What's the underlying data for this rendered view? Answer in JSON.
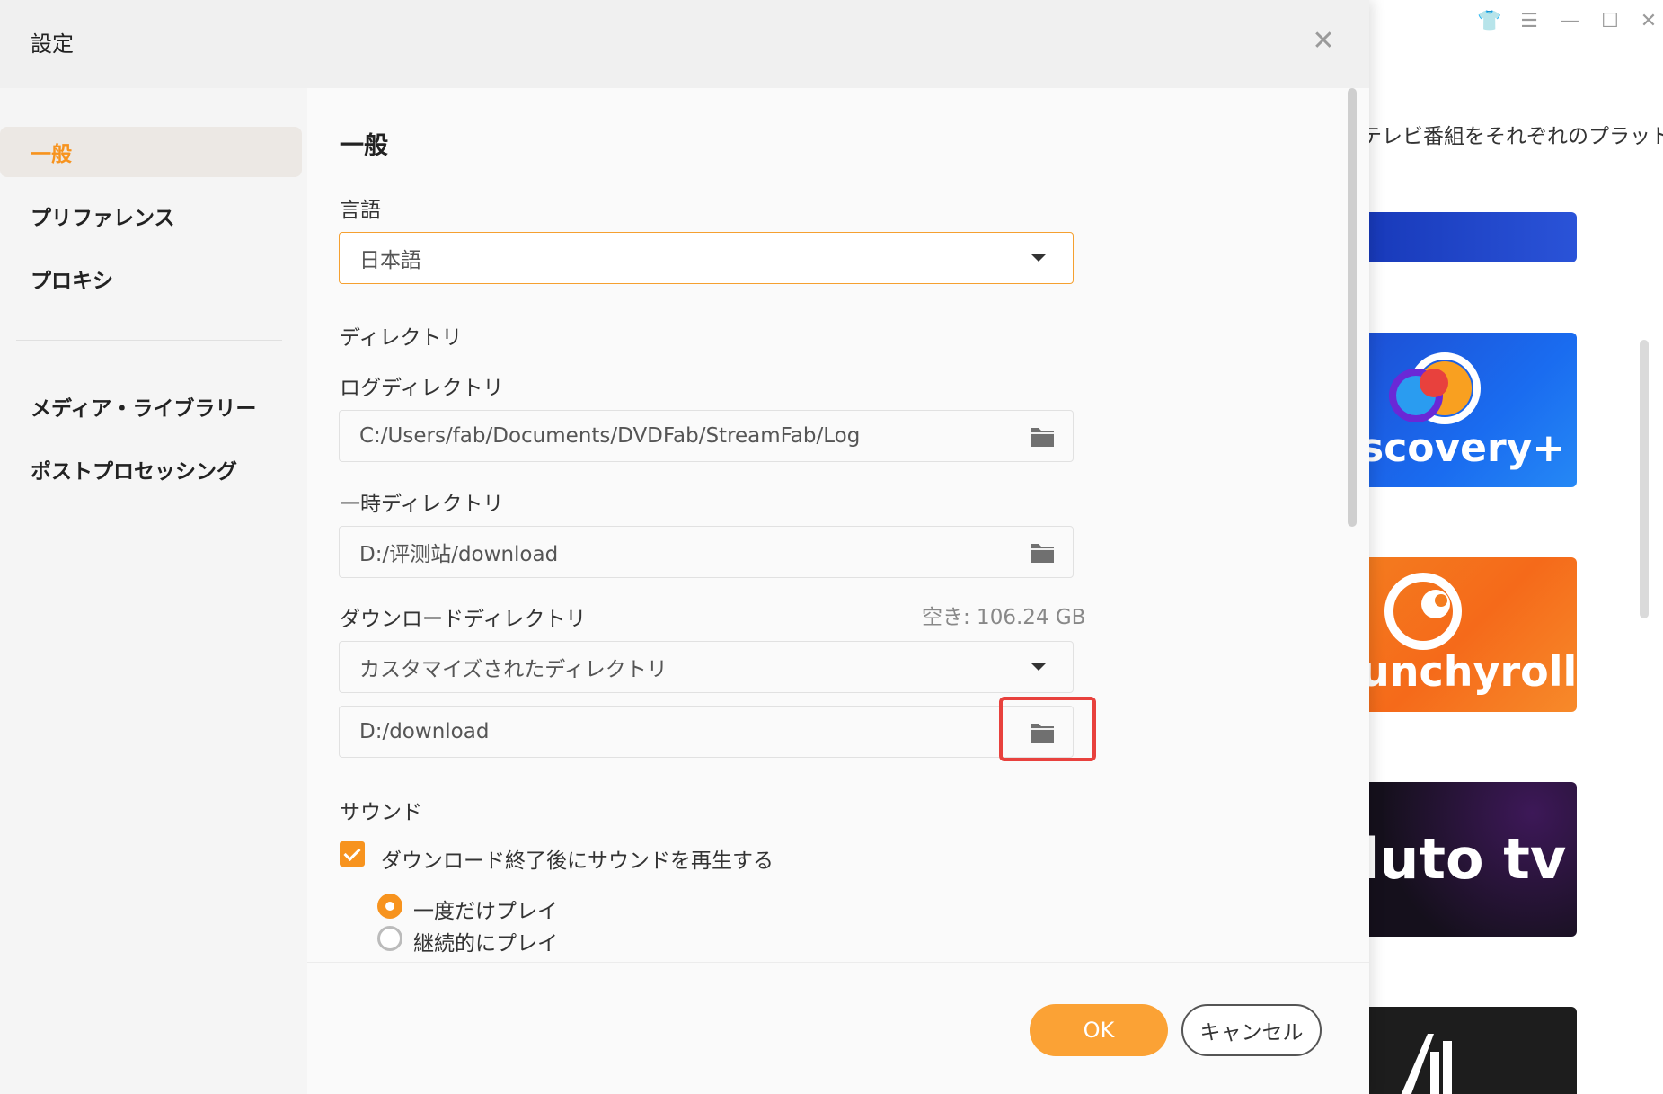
{
  "colors": {
    "accent": "#f7931e",
    "ok_button": "#fba235",
    "highlight": "#e8413d"
  },
  "background_app": {
    "window_controls": [
      {
        "icon": "skin-icon",
        "glyph": "👕"
      },
      {
        "icon": "menu-icon",
        "glyph": "☰"
      },
      {
        "icon": "minimize-icon",
        "glyph": "—"
      },
      {
        "icon": "maximize-icon",
        "glyph": "☐"
      },
      {
        "icon": "close-icon",
        "glyph": "✕"
      }
    ],
    "description": "テレビ番組をそれぞれのプラット",
    "tiles": [
      {
        "name": "blue",
        "text": ""
      },
      {
        "name": "discovery",
        "text": "scovery+"
      },
      {
        "name": "crunchyroll",
        "text": "unchyroll"
      },
      {
        "name": "pluto",
        "text": "luto tv"
      },
      {
        "name": "fourth",
        "text": ""
      }
    ]
  },
  "dialog": {
    "title": "設定",
    "close_glyph": "✕"
  },
  "sidebar": {
    "items": [
      {
        "label": "一般",
        "active": true
      },
      {
        "label": "プリファレンス",
        "active": false
      },
      {
        "label": "プロキシ",
        "active": false
      },
      {
        "label": "メディア・ライブラリー",
        "active": false
      },
      {
        "label": "ポストプロセッシング",
        "active": false
      }
    ]
  },
  "general": {
    "title": "一般",
    "language": {
      "label": "言語",
      "value": "日本語"
    },
    "directory": {
      "label": "ディレクトリ",
      "log": {
        "label": "ログディレクトリ",
        "value": "C:/Users/fab/Documents/DVDFab/StreamFab/Log"
      },
      "temp": {
        "label": "一時ディレクトリ",
        "value": "D:/评测站/download"
      },
      "download": {
        "label": "ダウンロードディレクトリ",
        "free_space": "空き: 106.24 GB",
        "mode": "カスタマイズされたディレクトリ",
        "path": "D:/download"
      }
    },
    "sound": {
      "label": "サウンド",
      "checkbox_label": "ダウンロード終了後にサウンドを再生する",
      "checked": true,
      "options": [
        {
          "label": "一度だけプレイ",
          "selected": true
        },
        {
          "label": "継続的にプレイ",
          "selected": false
        }
      ]
    }
  },
  "footer": {
    "ok_label": "OK",
    "cancel_label": "キャンセル"
  }
}
